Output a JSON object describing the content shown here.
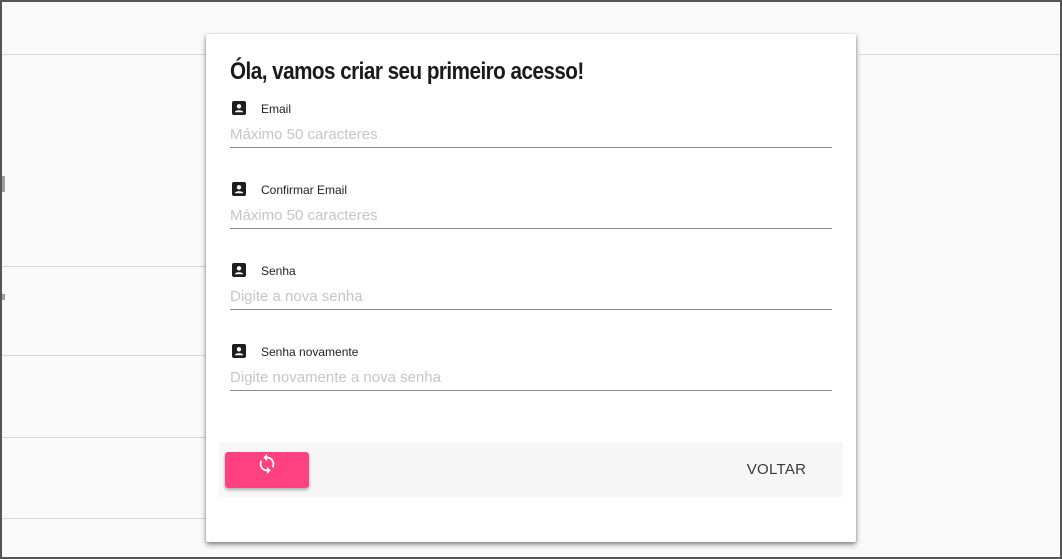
{
  "dialog": {
    "title": "Óla, vamos criar seu primeiro acesso!",
    "fields": [
      {
        "label": "Email",
        "placeholder": "Máximo 50 caracteres",
        "icon": "account-box-icon"
      },
      {
        "label": "Confirmar Email",
        "placeholder": "Máximo 50 caracteres",
        "icon": "account-box-icon"
      },
      {
        "label": "Senha",
        "placeholder": "Digite a nova senha",
        "icon": "account-box-icon"
      },
      {
        "label": "Senha novamente",
        "placeholder": "Digite novamente a nova senha",
        "icon": "account-box-icon"
      }
    ],
    "actions": {
      "refresh_icon": "refresh-icon",
      "back_label": "VOLTAR"
    }
  },
  "colors": {
    "accent": "#ff4081",
    "overlay_bg": "#fafafa",
    "dialog_bg": "#ffffff",
    "actions_bg": "#f7f7f7"
  }
}
